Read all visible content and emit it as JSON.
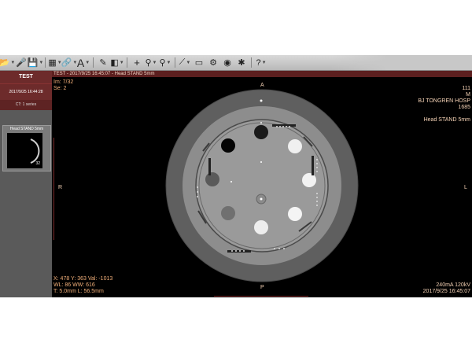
{
  "toolbar": {
    "tools": [
      "folder-open-icon",
      "microphone-icon",
      "save-disk-icon",
      "layout-grid-icon",
      "link-icon",
      "text-annotation-icon",
      "pen-tool-icon",
      "crosshair-icon",
      "magic-wand-icon",
      "magnifier-icon",
      "contrast-icon",
      "screen-capture-icon",
      "cine-icon",
      "3d-sphere-icon",
      "settings-icon",
      "help-icon"
    ]
  },
  "left_panel": {
    "patient_name": "TEST",
    "study_date": "2017/9/25 16:44:28",
    "series_count": "CT: 1 series",
    "series_label": "Head STAND 5mm",
    "thumb_count": "32"
  },
  "viewport": {
    "title_bar": "TEST - 2017/9/25 16:45:07 - Head STAND 5mm",
    "image_number": "Im: 7/32",
    "series_number": "Se: 2",
    "top_right": [
      "111",
      "M",
      "BJ TONGREN HOSP",
      "1685"
    ],
    "series_desc": "Head STAND 5mm",
    "orientation": {
      "top": "A",
      "bottom": "P",
      "left": "R",
      "right": "L"
    },
    "bottom_left": [
      "X: 478 Y: 363 Val: -1013",
      "WL: 86 WW: 616",
      "T: 5.0mm L: 56.5mm"
    ],
    "bottom_right": [
      "240mA 120kV",
      "2017/9/25 16:45:07"
    ]
  },
  "colors": {
    "accent": "#f3b07a",
    "title_bar": "#5c1f1f",
    "panel": "#6d2b2b"
  }
}
